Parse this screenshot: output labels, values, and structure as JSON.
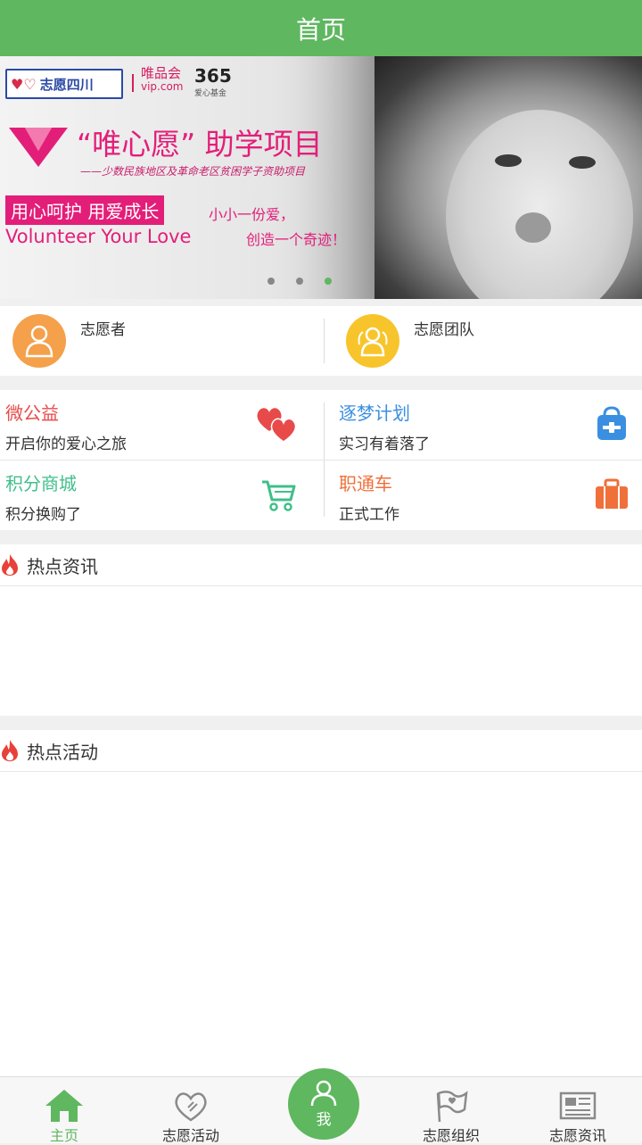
{
  "header": {
    "title": "首页"
  },
  "banner": {
    "logo_text": "志愿四川",
    "vip_text": "唯品会",
    "vip_sub": "vip.com",
    "brand_365": "365",
    "brand_365_sub": "爱心基金",
    "project_title": "“唯心愿” 助学项目",
    "subtitle": "——少数民族地区及革命老区贫困学子资助项目",
    "slogan": "用心呵护  用爱成长",
    "english": "Volunteer Your Love",
    "line1": "小小一份爱，",
    "line2": "创造一个奇迹！"
  },
  "quick": [
    {
      "label": "志愿者",
      "color": "#f5a04a"
    },
    {
      "label": "志愿团队",
      "color": "#f7c52b"
    }
  ],
  "features": [
    {
      "title": "微公益",
      "sub": "开启你的爱心之旅",
      "color": "#e84a4a",
      "icon": "hearts-icon"
    },
    {
      "title": "逐梦计划",
      "sub": "实习有着落了",
      "color": "#3a8fe0",
      "icon": "backpack-icon"
    },
    {
      "title": "积分商城",
      "sub": "积分换购了",
      "color": "#3fbf8a",
      "icon": "cart-icon"
    },
    {
      "title": "职通车",
      "sub": "正式工作",
      "color": "#f0703a",
      "icon": "briefcase-icon"
    }
  ],
  "sections": [
    {
      "title": "热点资讯"
    },
    {
      "title": "热点活动"
    }
  ],
  "tabs": [
    {
      "label": "主页",
      "active": true
    },
    {
      "label": "志愿活动"
    },
    {
      "label": "我"
    },
    {
      "label": "志愿组织"
    },
    {
      "label": "志愿资讯"
    }
  ],
  "colors": {
    "brand": "#5fb760",
    "accent_pink": "#e31e79"
  }
}
